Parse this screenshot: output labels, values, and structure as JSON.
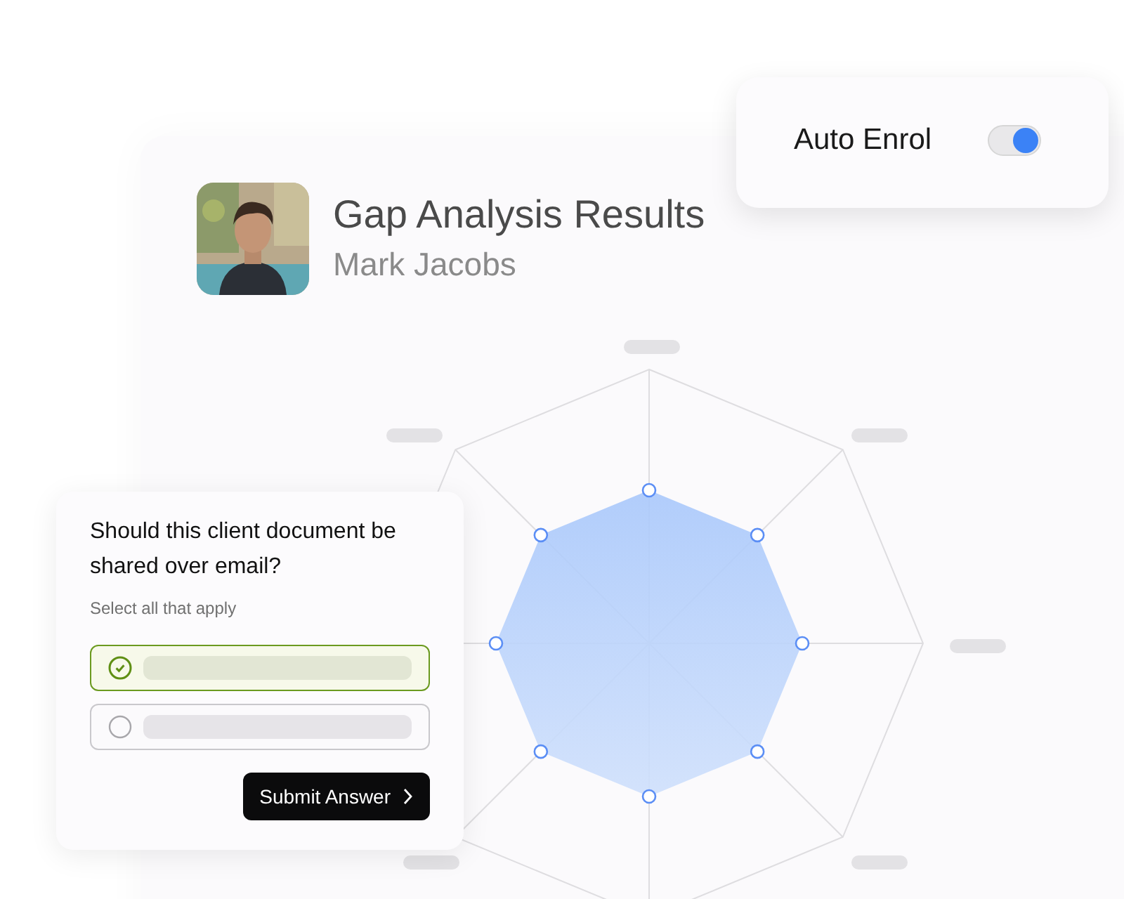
{
  "toggle_card": {
    "label": "Auto Enrol",
    "on": true
  },
  "results": {
    "title": "Gap Analysis Results",
    "subtitle": "Mark Jacobs"
  },
  "question": {
    "text": "Should this client document be shared over email?",
    "hint": "Select all that apply",
    "options": [
      {
        "checked": true
      },
      {
        "checked": false
      }
    ],
    "button": "Submit Answer"
  }
}
